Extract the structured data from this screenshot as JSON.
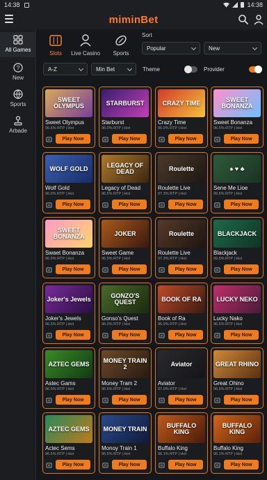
{
  "statusbar": {
    "time_left": "14:38",
    "time_right": "14:38"
  },
  "header": {
    "logo_text": "miminBet"
  },
  "sidebar": {
    "items": [
      {
        "label": "All Games",
        "icon": "grid-icon"
      },
      {
        "label": "New",
        "icon": "question-icon"
      },
      {
        "label": "Sports",
        "icon": "ball-icon"
      },
      {
        "label": "Arbade",
        "icon": "joystick-icon"
      }
    ]
  },
  "categories": [
    {
      "label": "Slots",
      "icon": "slot-machine-icon"
    },
    {
      "label": "Live Casino",
      "icon": "dealer-icon"
    },
    {
      "label": "Sports",
      "icon": "football-icon"
    }
  ],
  "sort": {
    "label": "Sort",
    "value1": "Popular",
    "value2": "New"
  },
  "filters": {
    "az": "A-Z",
    "min_bet": "Min Bet",
    "theme_label": "Theme",
    "provider_label": "Provider"
  },
  "play_label": "Play Now",
  "accent": "#f07b1d",
  "games": [
    {
      "name": "Sweet Olympus",
      "meta": "96.5% RTP | Hot",
      "thumb": "SWEET OLYMPUS",
      "c1": "#d8a85a",
      "c2": "#7a3f9a"
    },
    {
      "name": "Starburst",
      "meta": "96.0% RTP | Hot",
      "thumb": "STARBURST",
      "c1": "#3a1d6e",
      "c2": "#c23fb4"
    },
    {
      "name": "Crazy Time",
      "meta": "96.0% RTP | Hot",
      "thumb": "CRAZY TIME",
      "c1": "#d23a2c",
      "c2": "#f5c13a"
    },
    {
      "name": "Sweet Bonanza",
      "meta": "96.5% RTP | Hot",
      "thumb": "SWEET BONANZA",
      "c1": "#ff8fc8",
      "c2": "#6ec1ff"
    },
    {
      "name": "Wolf Gold",
      "meta": "96.0% RTP | Hot",
      "thumb": "WOLF GOLD",
      "c1": "#3a5fb0",
      "c2": "#1a2c66"
    },
    {
      "name": "Legacy of Dead",
      "meta": "96.5% RTP | Hot",
      "thumb": "LEGACY OF DEAD",
      "c1": "#b07a2a",
      "c2": "#3a2512"
    },
    {
      "name": "Roulette Live",
      "meta": "97.3% RTP | Hot",
      "thumb": "Roulette",
      "c1": "#4a3a2a",
      "c2": "#1e1712"
    },
    {
      "name": "Sene Me Lioe",
      "meta": "99.5% RTP | Hot",
      "thumb": "♠ ♥ ♣",
      "c1": "#2f5a3a",
      "c2": "#1b3322"
    },
    {
      "name": "Swaet Bonanza",
      "meta": "96.5% RTP | Hot",
      "thumb": "SWEET BONANZA",
      "c1": "#ff9ac6",
      "c2": "#ffd46b"
    },
    {
      "name": "Sweet Game",
      "meta": "96.5% RTP | Hot",
      "thumb": "JOKER",
      "c1": "#a85a1a",
      "c2": "#3a1810"
    },
    {
      "name": "Roulette Live",
      "meta": "97.3% RTP | Hot",
      "thumb": "Roulette",
      "c1": "#553a28",
      "c2": "#1e1510"
    },
    {
      "name": "Blackjack",
      "meta": "99.5% RTP | Hot",
      "thumb": "BLACKJACK",
      "c1": "#1f6a4a",
      "c2": "#0f3326"
    },
    {
      "name": "Joker's Jewels",
      "meta": "96.5% RTP | Hot",
      "thumb": "Joker's Jewels",
      "c1": "#7a2a9a",
      "c2": "#2a0f40"
    },
    {
      "name": "Gonso's Quest",
      "meta": "96.0% RTP | Hot",
      "thumb": "GONZO'S QUEST",
      "c1": "#4a6a2a",
      "c2": "#1a2a10"
    },
    {
      "name": "Book of Ra",
      "meta": "96.0% RTP | Hot",
      "thumb": "BOOK OF RA",
      "c1": "#c04a2a",
      "c2": "#3a1a10"
    },
    {
      "name": "Lucky Nako",
      "meta": "96.5% RTP | Hot",
      "thumb": "LUCKY NEKO",
      "c1": "#c0306a",
      "c2": "#4a1a3a"
    },
    {
      "name": "Astec Gams",
      "meta": "96.5% RTP | Hot",
      "thumb": "AZTEC GEMS",
      "c1": "#3a8a2a",
      "c2": "#123a10"
    },
    {
      "name": "Money Tram 2",
      "meta": "96.5% RTP | Hot",
      "thumb": "MONEY TRAIN 2",
      "c1": "#6a4a2a",
      "c2": "#2a1a10"
    },
    {
      "name": "Aviator",
      "meta": "97.0% RTP | Hot",
      "thumb": "Aviator",
      "c1": "#2a2a2e",
      "c2": "#151518"
    },
    {
      "name": "Great Ohino",
      "meta": "96.5% RTP | Hot",
      "thumb": "GREAT RHINO",
      "c1": "#d08a3a",
      "c2": "#5a3010"
    },
    {
      "name": "Actec Sems",
      "meta": "96.5% RTP | Hot",
      "thumb": "AZTEC GEMS",
      "c1": "#2a8a5a",
      "c2": "#c07a1a"
    },
    {
      "name": "Monoy Train 1",
      "meta": "96.5% RTP | Hot",
      "thumb": "MONEY TRAIN",
      "c1": "#2a4a8a",
      "c2": "#101a3a"
    },
    {
      "name": "Buffalo King",
      "meta": "96.1% RTP | Hot",
      "thumb": "BUFFALO KING",
      "c1": "#c05a1a",
      "c2": "#4a1a0a"
    },
    {
      "name": "Buffalo King",
      "meta": "96.1% RTP | Hot",
      "thumb": "BUFFALO KING",
      "c1": "#d0661a",
      "c2": "#5a200a"
    }
  ]
}
